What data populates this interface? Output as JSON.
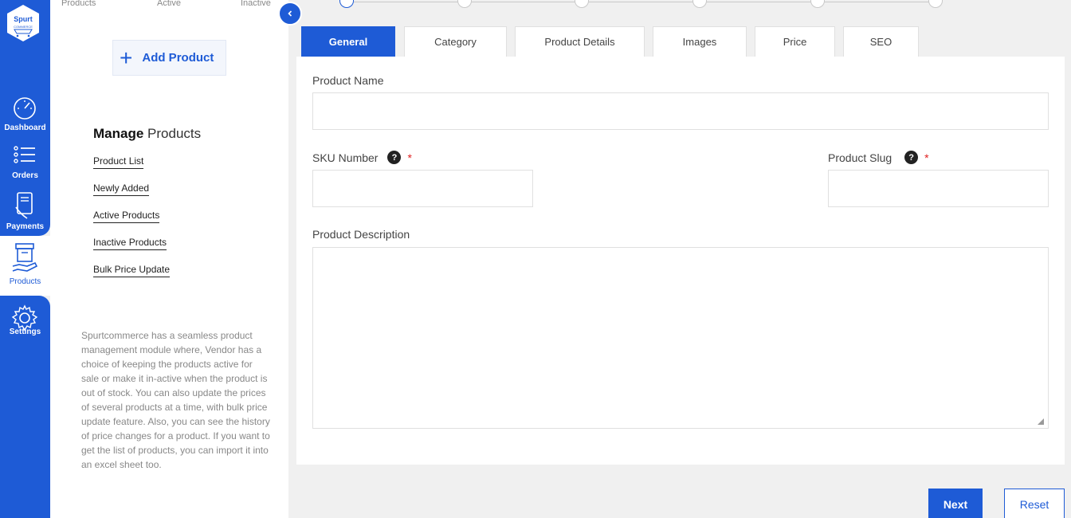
{
  "brand": {
    "logo_text": "Spurt",
    "logo_subtext": "COMMERCE",
    "accent": "#1e5bd6"
  },
  "rail": {
    "items": [
      {
        "label": "Dashboard",
        "icon": "speedometer-icon"
      },
      {
        "label": "Orders",
        "icon": "list-icon"
      },
      {
        "label": "Payments",
        "icon": "payment-card-icon"
      },
      {
        "label": "Products",
        "icon": "box-hand-icon",
        "active": true
      },
      {
        "label": "Settings",
        "icon": "gear-icon"
      }
    ]
  },
  "panel": {
    "top_tabs": [
      "Products",
      "Active",
      "Inactive"
    ],
    "add_button": "Add Product",
    "manage_title_bold": "Manage",
    "manage_title_rest": "Products",
    "links": [
      "Product List",
      "Newly Added",
      "Active Products",
      "Inactive Products",
      "Bulk Price Update"
    ],
    "description": "Spurtcommerce has a seamless product management module where, Vendor has a choice of keeping the products active for sale or make it in-active when the product is out of stock. You can also update the prices of several products at a time, with bulk price update feature. Also, you can see the history of price changes for a product. If you want to get the list of products, you can import it into an excel sheet too."
  },
  "collapse_icon": "chevron-left-icon",
  "stepper": {
    "steps": 6,
    "current": 1
  },
  "tabs": [
    "General",
    "Category",
    "Product Details",
    "Images",
    "Price",
    "SEO"
  ],
  "active_tab": "General",
  "form": {
    "product_name_label": "Product Name",
    "product_name_value": "",
    "sku_label": "SKU Number",
    "sku_value": "",
    "slug_label": "Product Slug",
    "slug_value": "",
    "description_label": "Product Description",
    "description_value": "",
    "help_glyph": "?",
    "required_mark": "*"
  },
  "buttons": {
    "next": "Next",
    "reset": "Reset"
  }
}
